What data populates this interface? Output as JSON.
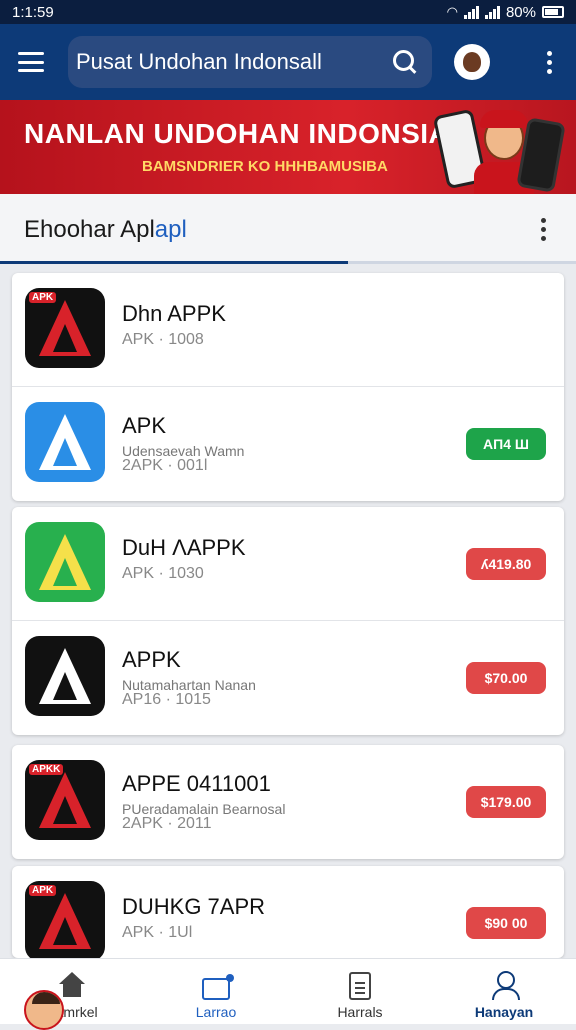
{
  "status_bar": {
    "time": "1:1:59",
    "battery": "80%"
  },
  "app_bar": {
    "search_text": "Pusat Undohan Indonsall"
  },
  "banner": {
    "title": "NANLAN UNDOHAN INDONSIA",
    "subtitle": "BAMSNDRIER KO HHHBAMUSIBA"
  },
  "section": {
    "title_main": "Ehoohar Apl",
    "title_accent": "apl"
  },
  "apps": [
    {
      "name": "Dhn APPK",
      "desc": "",
      "meta": "APK · 1008",
      "price": "",
      "price_color": "",
      "icon_bg": "#111111",
      "icon_fg": "#d8222a",
      "icon_tag": "APK"
    },
    {
      "name": "APK",
      "desc": "Udensaevah Wamn",
      "meta": "2APK · 001l",
      "price": "AП4 Ш",
      "price_color": "green",
      "icon_bg": "#2a8ee6",
      "icon_fg": "#ffffff",
      "icon_tag": ""
    },
    {
      "name": "DuH ɅAPPK",
      "desc": "",
      "meta": "APK · 1030",
      "price": "ʎ419.80",
      "price_color": "red",
      "icon_bg": "#28b04e",
      "icon_fg": "#f5e04a",
      "icon_tag": ""
    },
    {
      "name": "APPK",
      "desc": "Nutamahartan Nanan",
      "meta": "AP16 · 1015",
      "price": "$70.00",
      "price_color": "red",
      "icon_bg": "#111111",
      "icon_fg": "#ffffff",
      "icon_tag": ""
    },
    {
      "name": "APPE 0411001",
      "desc": "PUeradamalain Bearnosal",
      "meta": "2APK · 2011",
      "price": "$179.00",
      "price_color": "red",
      "icon_bg": "#111111",
      "icon_fg": "#d8222a",
      "icon_tag": "APKK"
    },
    {
      "name": "DUHKG 7APR",
      "desc": "",
      "meta": "APK · 1Ul",
      "price": "$90 00",
      "price_color": "red",
      "icon_bg": "#111111",
      "icon_fg": "#d8222a",
      "icon_tag": "APK"
    }
  ],
  "bottom_nav": [
    {
      "label": "Kamrkel",
      "icon": "home-icon"
    },
    {
      "label": "Larrao",
      "icon": "screen-icon"
    },
    {
      "label": "Harrals",
      "icon": "document-icon"
    },
    {
      "label": "Hanayan",
      "icon": "user-icon"
    }
  ],
  "colors": {
    "primary": "#0d3a78",
    "accent": "#1f5fbf",
    "banner": "#d8222a",
    "green": "#1ea44a",
    "red": "#e04848"
  }
}
